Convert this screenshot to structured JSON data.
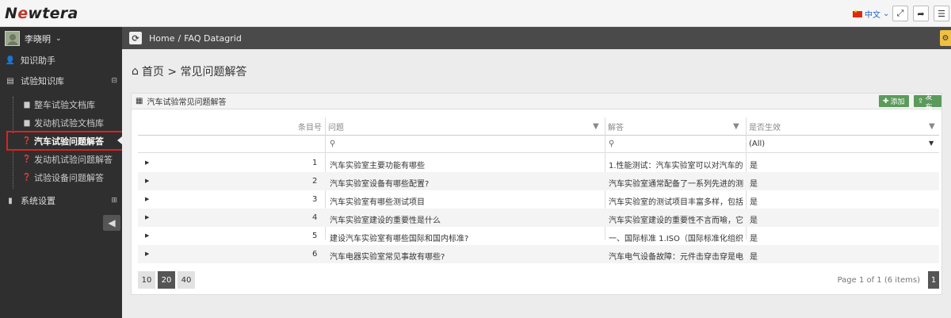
{
  "app": {
    "logo_prefix": "N",
    "logo_o": "e",
    "logo_suffix": "wtera",
    "language": "中文",
    "accent_color": "#5b9a5b"
  },
  "sidebar": {
    "user_name": "李晓明",
    "items": [
      {
        "label": "知识助手",
        "icon": "user-icon"
      },
      {
        "label": "试验知识库",
        "icon": "database-icon"
      },
      {
        "label": "系统设置",
        "icon": "settings-icon"
      }
    ],
    "sub_items": [
      {
        "label": "整车试验文档库",
        "icon": "folder-icon"
      },
      {
        "label": "发动机试验文档库",
        "icon": "folder-icon"
      },
      {
        "label": "汽车试验问题解答",
        "icon": "question-icon"
      },
      {
        "label": "发动机试验问题解答",
        "icon": "question-icon"
      },
      {
        "label": "试验设备问题解答",
        "icon": "question-icon"
      }
    ]
  },
  "breadcrumb": {
    "home": "Home",
    "separator": "/",
    "current": "FAQ Datagrid"
  },
  "page": {
    "title": "首页 > 常见问题解答"
  },
  "panel": {
    "title": "汽车试验常见问题解答",
    "add_label": "添加",
    "publish_label": "发布"
  },
  "grid": {
    "columns": {
      "index": "条目号",
      "question": "问题",
      "answer": "解答",
      "active": "是否生效"
    },
    "filter_active": "(All)",
    "rows": [
      {
        "index": "1",
        "question": "汽车实验室主要功能有哪些",
        "answer": "1.性能测试：汽车实验室可以对汽车的...",
        "active": "是"
      },
      {
        "index": "2",
        "question": "汽车实验室设备有哪些配置?",
        "answer": "汽车实验室通常配备了一系列先进的测...",
        "active": "是"
      },
      {
        "index": "3",
        "question": "汽车实验室有哪些测试项目",
        "answer": "汽车实验室的测试项目丰富多样，包括...",
        "active": "是"
      },
      {
        "index": "4",
        "question": "汽车实验室建设的重要性是什么",
        "answer": "汽车实验室建设的重要性不言而喻，它...",
        "active": "是"
      },
      {
        "index": "5",
        "question": "建设汽车实验室有哪些国际和国内标准?",
        "answer": "一、国际标准 1.ISO（国际标准化组织...",
        "active": "是"
      },
      {
        "index": "6",
        "question": "汽车电器实验室常见事故有哪些?",
        "answer": "汽车电气设备故障：元件击穿击穿是电...",
        "active": "是"
      }
    ]
  },
  "pager": {
    "sizes": [
      "10",
      "20",
      "40"
    ],
    "selected_size": "20",
    "info": "Page 1 of 1 (6 items)",
    "current_page": "1"
  }
}
